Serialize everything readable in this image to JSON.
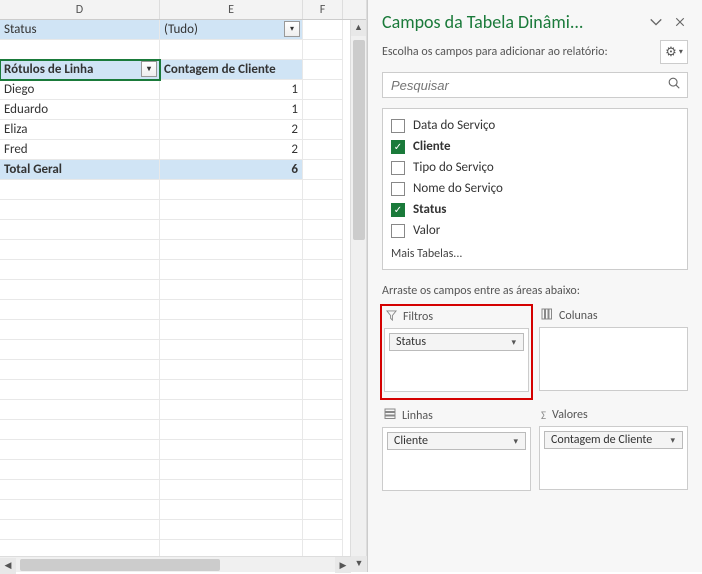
{
  "sheet": {
    "columns": [
      "D",
      "E",
      "F"
    ],
    "filterRow": {
      "label": "Status",
      "value": "(Tudo)"
    },
    "headerRow": {
      "d": "Rótulos de Linha",
      "e": "Contagem de Cliente"
    },
    "dataRows": [
      {
        "name": "Diego",
        "value": "1"
      },
      {
        "name": "Eduardo",
        "value": "1"
      },
      {
        "name": "Eliza",
        "value": "2"
      },
      {
        "name": "Fred",
        "value": "2"
      }
    ],
    "totalRow": {
      "label": "Total Geral",
      "value": "6"
    }
  },
  "panel": {
    "title": "Campos da Tabela Dinâmi...",
    "subtitle": "Escolha os campos para adicionar ao relatório:",
    "searchPlaceholder": "Pesquisar",
    "fields": [
      {
        "label": "Data do Serviço",
        "checked": false
      },
      {
        "label": "Cliente",
        "checked": true
      },
      {
        "label": "Tipo do Serviço",
        "checked": false
      },
      {
        "label": "Nome do Serviço",
        "checked": false
      },
      {
        "label": "Status",
        "checked": true
      },
      {
        "label": "Valor",
        "checked": false
      }
    ],
    "moreTables": "Mais Tabelas...",
    "dragHint": "Arraste os campos entre as áreas abaixo:",
    "areas": {
      "filters": {
        "label": "Filtros",
        "items": [
          "Status"
        ]
      },
      "columns": {
        "label": "Colunas",
        "items": []
      },
      "rows": {
        "label": "Linhas",
        "items": [
          "Cliente"
        ]
      },
      "values": {
        "label": "Valores",
        "items": [
          "Contagem de Cliente"
        ]
      }
    }
  }
}
